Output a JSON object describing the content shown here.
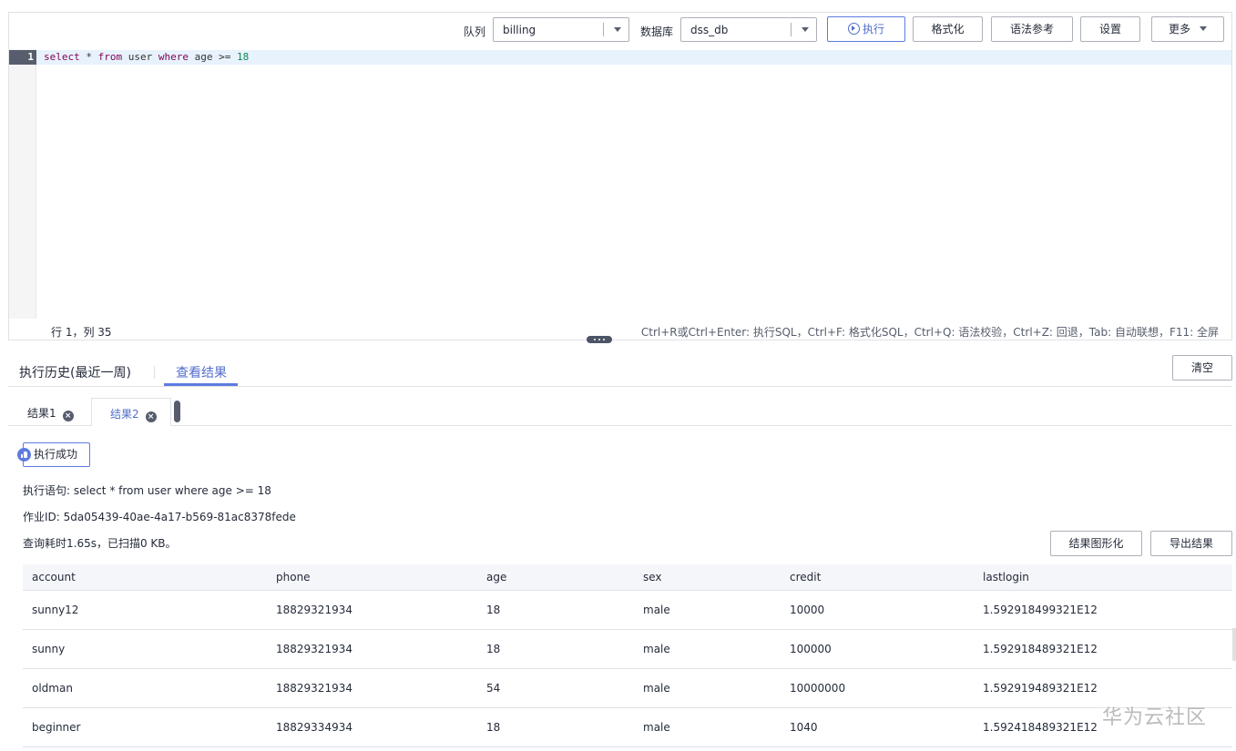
{
  "toolbar": {
    "queue_label": "队列",
    "queue_value": "billing",
    "db_label": "数据库",
    "db_value": "dss_db",
    "execute_label": "执行",
    "format_label": "格式化",
    "syntax_label": "语法参考",
    "settings_label": "设置",
    "more_label": "更多"
  },
  "editor": {
    "line_number": "1",
    "code_tokens": [
      {
        "text": "select",
        "kind": "kw"
      },
      {
        "text": " * ",
        "kind": "op"
      },
      {
        "text": "from",
        "kind": "kw"
      },
      {
        "text": " user ",
        "kind": "id"
      },
      {
        "text": "where",
        "kind": "kw"
      },
      {
        "text": " age ",
        "kind": "id"
      },
      {
        "text": ">=",
        "kind": "op"
      },
      {
        "text": " 18",
        "kind": "num"
      }
    ],
    "cursor_position": "行 1，列 35",
    "shortcuts": "Ctrl+R或Ctrl+Enter: 执行SQL，Ctrl+F: 格式化SQL，Ctrl+Q: 语法校验，Ctrl+Z: 回退，Tab: 自动联想，F11: 全屏"
  },
  "result_tabs": {
    "history_label": "执行历史(最近一周)",
    "results_label": "查看结果",
    "clear_label": "清空"
  },
  "sub_tabs": [
    {
      "label": "结果1",
      "active": false
    },
    {
      "label": "结果2",
      "active": true
    }
  ],
  "result": {
    "status": "执行成功",
    "statement": "执行语句: select * from user where age >= 18",
    "job_id": "作业ID: 5da05439-40ae-4a17-b569-81ac8378fede",
    "time_info": "查询耗时1.65s，已扫描0 KB。",
    "chart_btn_label": "结果图形化",
    "export_btn_label": "导出结果"
  },
  "table": {
    "columns": [
      "account",
      "phone",
      "age",
      "sex",
      "credit",
      "lastlogin"
    ],
    "rows": [
      [
        "sunny12",
        "18829321934",
        "18",
        "male",
        "10000",
        "1.592918499321E12"
      ],
      [
        "sunny",
        "18829321934",
        "18",
        "male",
        "100000",
        "1.592918489321E12"
      ],
      [
        "oldman",
        "18829321934",
        "54",
        "male",
        "10000000",
        "1.592919489321E12"
      ],
      [
        "beginner",
        "18829334934",
        "18",
        "male",
        "1040",
        "1.592418489321E12"
      ]
    ]
  },
  "watermark": "华为云社区",
  "colors": {
    "accent": "#5e7ce0",
    "keyword": "#7f0055",
    "number": "#098658",
    "text": "#252b3a"
  }
}
